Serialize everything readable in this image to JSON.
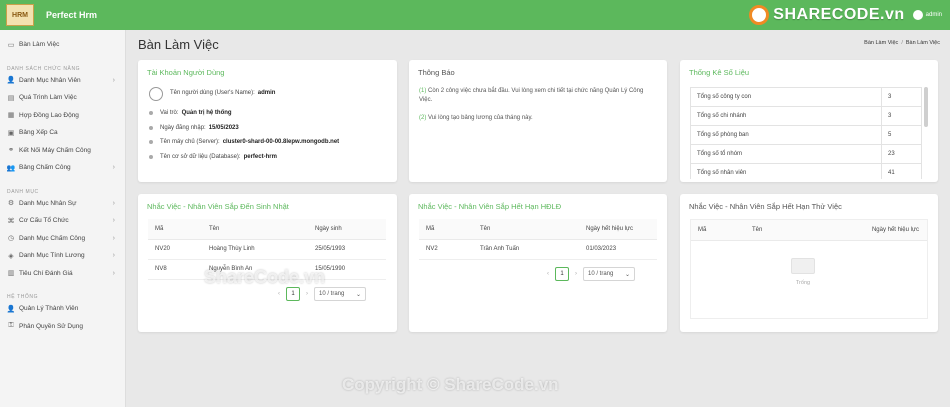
{
  "app": {
    "title": "Perfect Hrm",
    "logo_text": "HRM"
  },
  "topbar": {
    "brand_watermark": "SHARECODE.vn",
    "admin_label": "admin"
  },
  "sidebar": {
    "items_top": [
      {
        "label": "Bàn Làm Việc",
        "icon": "monitor-icon",
        "chevron": false
      }
    ],
    "sections": [
      {
        "title": "DANH SÁCH CHỨC NĂNG",
        "items": [
          {
            "label": "Danh Mục Nhân Viên",
            "icon": "users-icon",
            "chevron": true
          },
          {
            "label": "Quá Trình Làm Việc",
            "icon": "document-icon",
            "chevron": false
          },
          {
            "label": "Hợp Đồng Lao Động",
            "icon": "contract-icon",
            "chevron": false
          },
          {
            "label": "Bảng Xếp Ca",
            "icon": "calendar-icon",
            "chevron": false
          },
          {
            "label": "Kết Nối Máy Chấm Công",
            "icon": "link-icon",
            "chevron": false
          },
          {
            "label": "Bảng Chấm Công",
            "icon": "user-group-icon",
            "chevron": true
          }
        ]
      },
      {
        "title": "DANH MỤC",
        "items": [
          {
            "label": "Danh Mục Nhân Sự",
            "icon": "settings-icon",
            "chevron": true
          },
          {
            "label": "Cơ Cấu Tổ Chức",
            "icon": "org-icon",
            "chevron": true
          },
          {
            "label": "Danh Mục Chấm Công",
            "icon": "clock-icon",
            "chevron": true
          },
          {
            "label": "Danh Mục Tính Lương",
            "icon": "money-icon",
            "chevron": true
          },
          {
            "label": "Tiêu Chí Đánh Giá",
            "icon": "chart-icon",
            "chevron": true
          }
        ]
      },
      {
        "title": "HỆ THỐNG",
        "items": [
          {
            "label": "Quản Lý Thành Viên",
            "icon": "user-icon",
            "chevron": false
          },
          {
            "label": "Phân Quyền Sử Dụng",
            "icon": "permission-icon",
            "chevron": false
          }
        ]
      }
    ]
  },
  "page": {
    "title": "Bàn Làm Việc",
    "breadcrumb": [
      "Bàn Làm Việc",
      "Bàn Làm Việc"
    ]
  },
  "account_card": {
    "title": "Tài Khoản Người Dùng",
    "username_label": "Tên người dùng (User's Name):",
    "username_value": "admin",
    "rows": [
      {
        "label": "Vai trò:",
        "value": "Quản trị hệ thống"
      },
      {
        "label": "Ngày đăng nhập:",
        "value": "15/05/2023"
      },
      {
        "label": "Tên máy chủ (Server):",
        "value": "cluster0-shard-00-00.8lepw.mongodb.net"
      },
      {
        "label": "Tên cơ sở dữ liệu (Database):",
        "value": "perfect-hrm"
      }
    ]
  },
  "notice_card": {
    "title": "Thông Báo",
    "items": [
      {
        "num": "(1)",
        "text": "Còn 2 công việc chưa bắt đầu. Vui lòng xem chi tiết tại chức năng Quản Lý Công Việc."
      },
      {
        "num": "(2)",
        "text": "Vui lòng tạo bảng lương của tháng này."
      }
    ]
  },
  "stats_card": {
    "title": "Thống Kê Số Liệu",
    "rows": [
      {
        "label": "Tổng số công ty con",
        "value": "3"
      },
      {
        "label": "Tổng số chi nhánh",
        "value": "3"
      },
      {
        "label": "Tổng số phòng ban",
        "value": "5"
      },
      {
        "label": "Tổng số tổ nhóm",
        "value": "23"
      },
      {
        "label": "Tổng số nhân viên",
        "value": "41"
      }
    ]
  },
  "birthday_card": {
    "title": "Nhắc Việc - Nhân Viên Sắp Đến Sinh Nhật",
    "columns": [
      "Mã",
      "Tên",
      "Ngày sinh"
    ],
    "rows": [
      [
        "NV20",
        "Hoàng Thùy Linh",
        "25/05/1993"
      ],
      [
        "NV8",
        "Nguyễn Bình An",
        "15/05/1990"
      ]
    ],
    "page": "1",
    "page_size": "10 / trang"
  },
  "contract_card": {
    "title": "Nhắc Việc - Nhân Viên Sắp Hết Hạn HĐLĐ",
    "columns": [
      "Mã",
      "Tên",
      "Ngày hết hiệu lực"
    ],
    "rows": [
      [
        "NV2",
        "Trần Anh Tuấn",
        "01/03/2023"
      ]
    ],
    "page": "1",
    "page_size": "10 / trang"
  },
  "probation_card": {
    "title": "Nhắc Việc - Nhân Viên Sắp Hết Hạn Thử Việc",
    "columns": [
      "Mã",
      "Tên",
      "Ngày hết hiệu lực"
    ],
    "empty_text": "Trống"
  },
  "watermarks": {
    "middle": "ShareCode.vn",
    "bottom": "Copyright © ShareCode.vn"
  },
  "colors": {
    "primary": "#5cb85c",
    "background": "#e8e8e8"
  }
}
